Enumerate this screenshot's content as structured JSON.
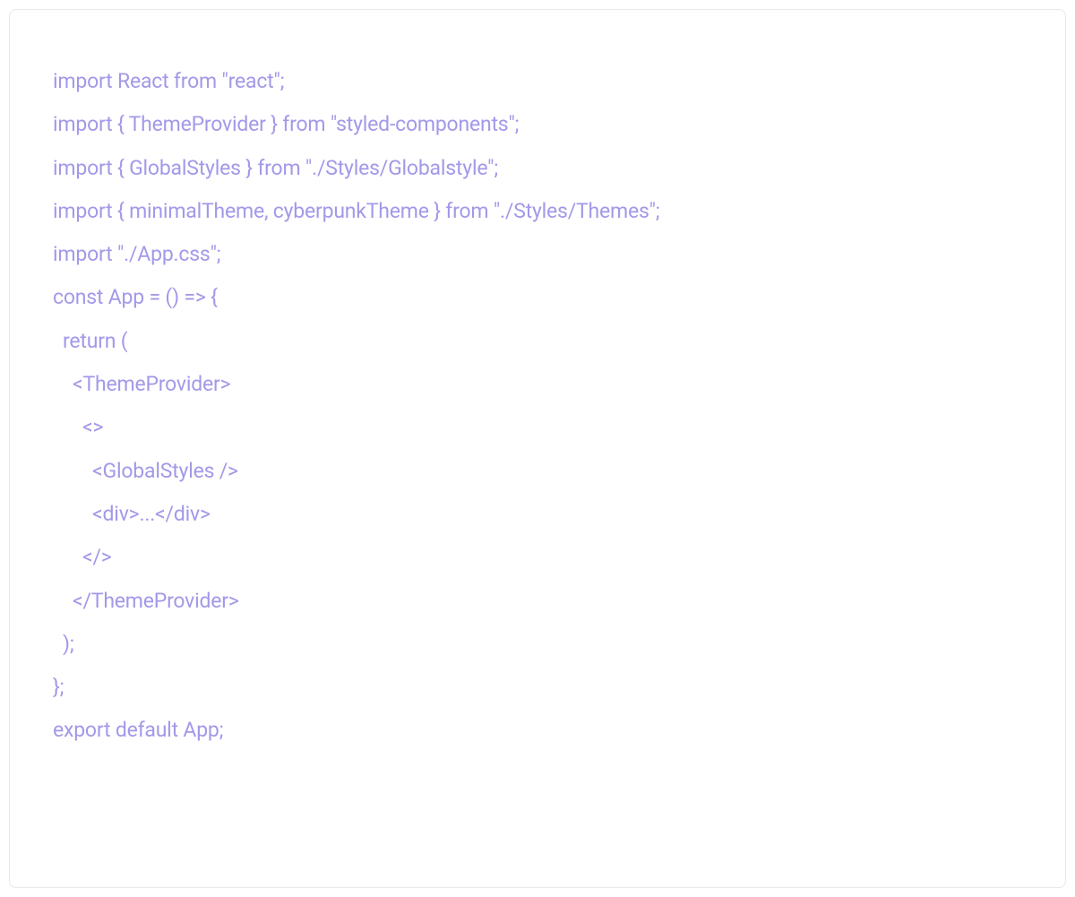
{
  "code": {
    "lines": [
      "import React from \"react\";",
      "import { ThemeProvider } from \"styled-components\";",
      "import { GlobalStyles } from \"./Styles/Globalstyle\";",
      "import { minimalTheme, cyberpunkTheme } from \"./Styles/Themes\";",
      "import \"./App.css\";",
      "",
      "const App = () => {",
      "  return (",
      "    <ThemeProvider>",
      "      <>",
      "        <GlobalStyles />",
      "        <div>...</div>",
      "      </>",
      "    </ThemeProvider>",
      "  );",
      "};",
      "export default App;"
    ]
  }
}
